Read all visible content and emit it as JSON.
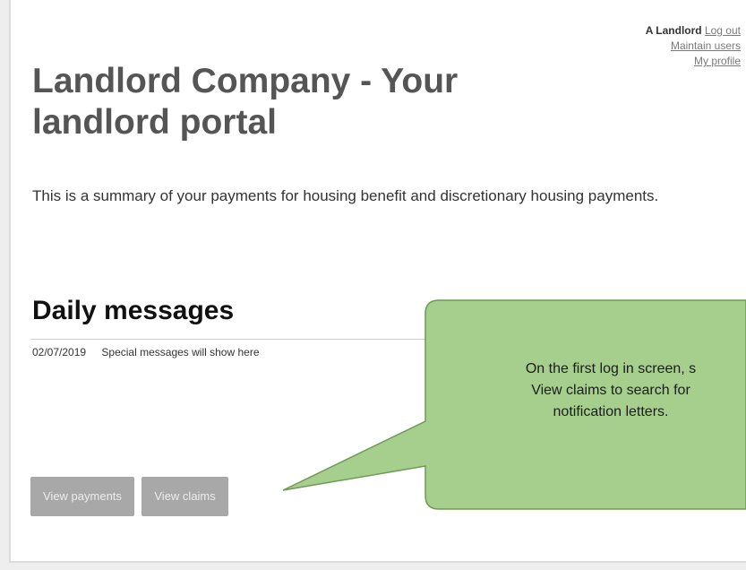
{
  "header": {
    "user_name": "A Landlord",
    "links": [
      "Log out",
      "Maintain users",
      "My profile"
    ]
  },
  "title": "Landlord Company - Your landlord portal",
  "summary": "This is a summary of your payments for housing benefit and discretionary housing payments.",
  "daily_messages": {
    "heading": "Daily messages",
    "items": [
      {
        "date": "02/07/2019",
        "text": "Special messages will show here"
      }
    ]
  },
  "actions": {
    "view_payments": "View payments",
    "view_claims": "View claims"
  },
  "callout": {
    "lines": [
      "On the first log in screen, s",
      "View claims to search for",
      "notification letters."
    ],
    "fill_color": "#a6cf8e",
    "border_color": "#6f9a55"
  }
}
